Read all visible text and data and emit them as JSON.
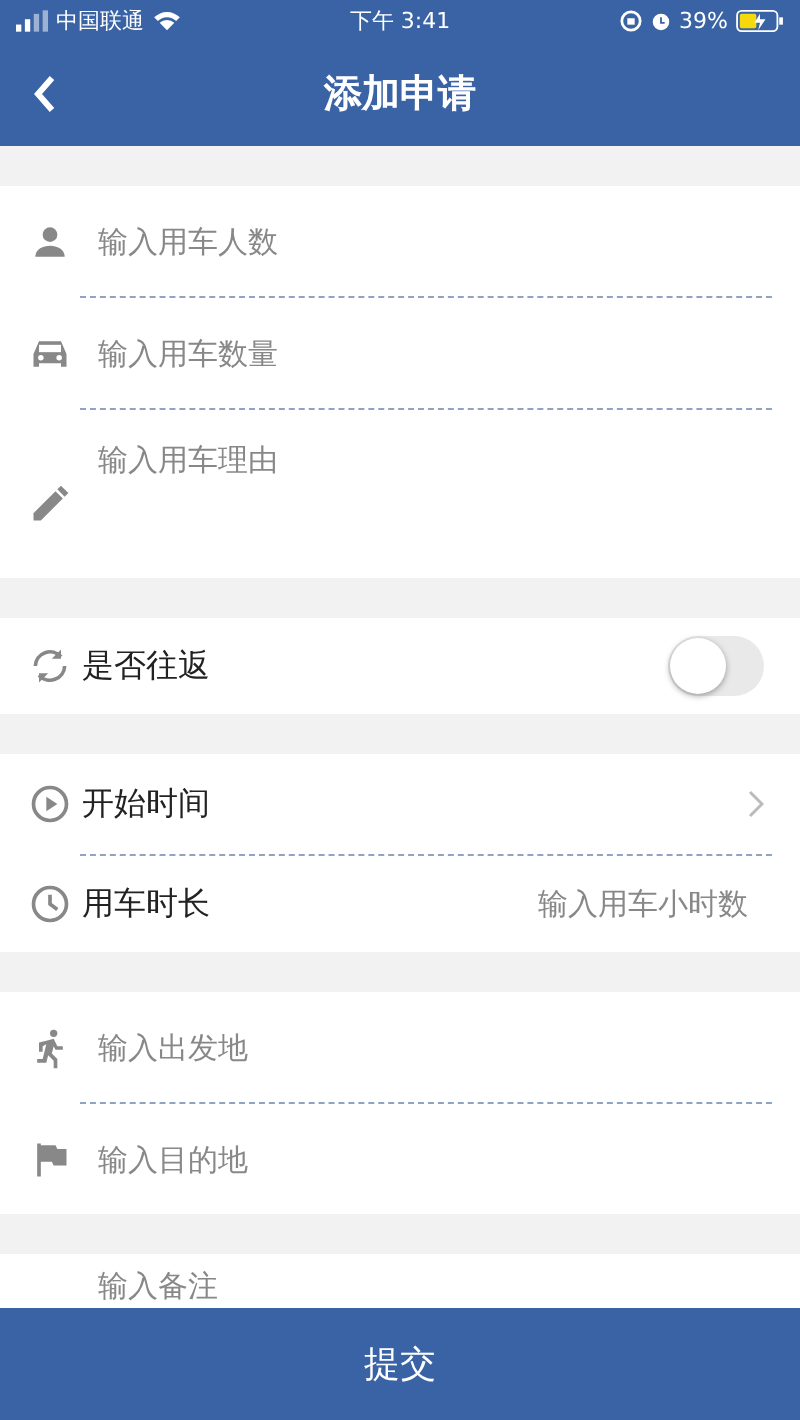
{
  "status_bar": {
    "carrier": "中国联通",
    "time": "下午 3:41",
    "battery": "39%"
  },
  "header": {
    "title": "添加申请"
  },
  "sections": [
    {
      "rows": [
        {
          "kind": "field",
          "placeholder": "输入用车人数"
        },
        {
          "kind": "field",
          "placeholder": "输入用车数量"
        },
        {
          "kind": "textarea",
          "placeholder": "输入用车理由"
        }
      ]
    },
    {
      "rows": [
        {
          "kind": "toggle",
          "label": "是否往返",
          "on": false
        }
      ]
    },
    {
      "rows": [
        {
          "kind": "nav",
          "label": "开始时间"
        },
        {
          "kind": "input",
          "label": "用车时长",
          "placeholder": "输入用车小时数"
        }
      ]
    },
    {
      "rows": [
        {
          "kind": "field",
          "placeholder": "输入出发地"
        },
        {
          "kind": "field",
          "placeholder": "输入目的地"
        }
      ]
    },
    {
      "rows": [
        {
          "kind": "remark",
          "placeholder": "输入备注"
        }
      ]
    }
  ],
  "submit": {
    "label": "提交"
  }
}
